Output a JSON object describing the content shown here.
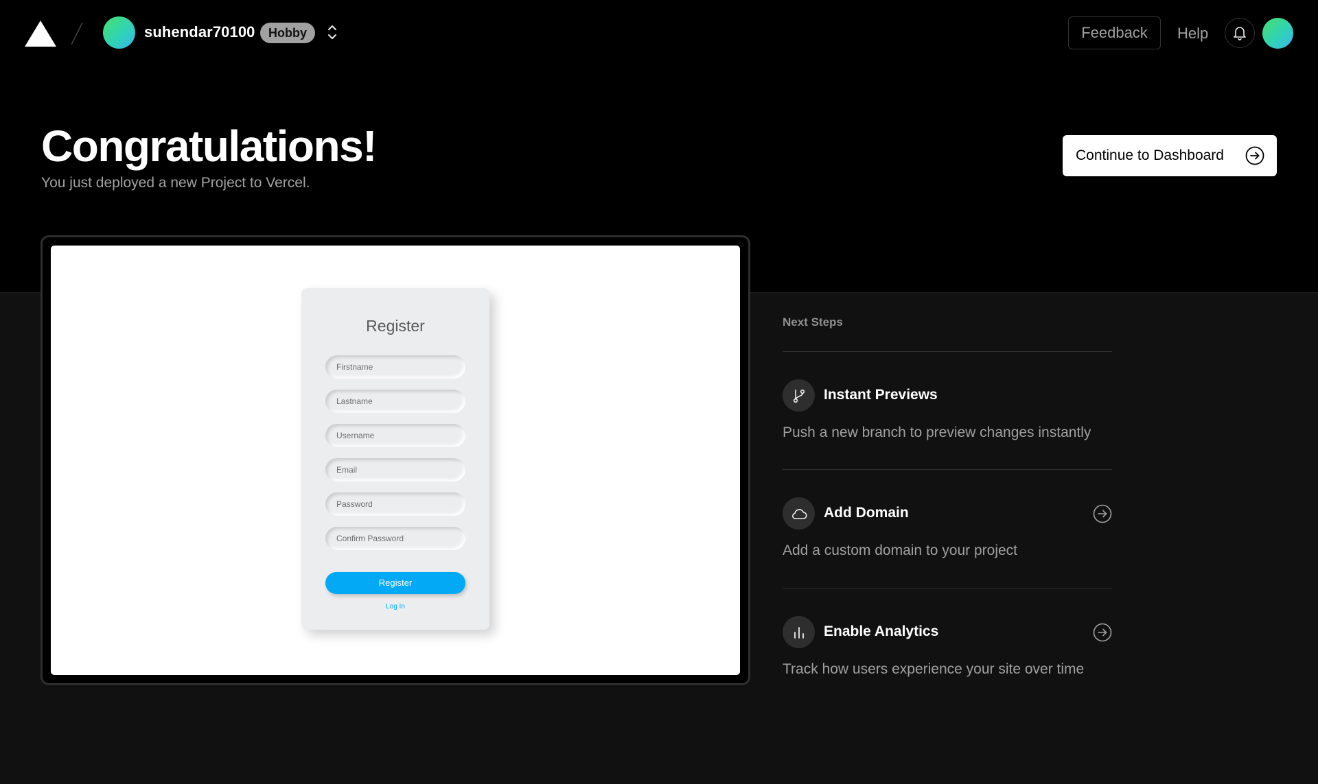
{
  "header": {
    "team_name": "suhendar70100",
    "plan_badge": "Hobby",
    "feedback_label": "Feedback",
    "help_label": "Help"
  },
  "hero": {
    "title": "Congratulations!",
    "subtitle": "You just deployed a new Project to Vercel.",
    "dashboard_button": "Continue to Dashboard"
  },
  "preview": {
    "form_title": "Register",
    "fields": [
      {
        "placeholder": "Firstname"
      },
      {
        "placeholder": "Lastname"
      },
      {
        "placeholder": "Username"
      },
      {
        "placeholder": "Email"
      },
      {
        "placeholder": "Password"
      },
      {
        "placeholder": "Confirm Password"
      }
    ],
    "submit_label": "Register",
    "login_link": "Log In",
    "accent_color": "#03a9f4"
  },
  "next_steps": {
    "label": "Next Steps",
    "items": [
      {
        "icon": "git-branch-icon",
        "title": "Instant Previews",
        "description": "Push a new branch to preview changes instantly"
      },
      {
        "icon": "cloud-icon",
        "title": "Add Domain",
        "description": "Add a custom domain to your project"
      },
      {
        "icon": "bar-chart-icon",
        "title": "Enable Analytics",
        "description": "Track how users experience your site over time"
      }
    ]
  },
  "colors": {
    "background_top": "#000000",
    "background_bottom": "#111111",
    "avatar_gradient_start": "#49e06a",
    "avatar_gradient_end": "#3ab6f0"
  }
}
